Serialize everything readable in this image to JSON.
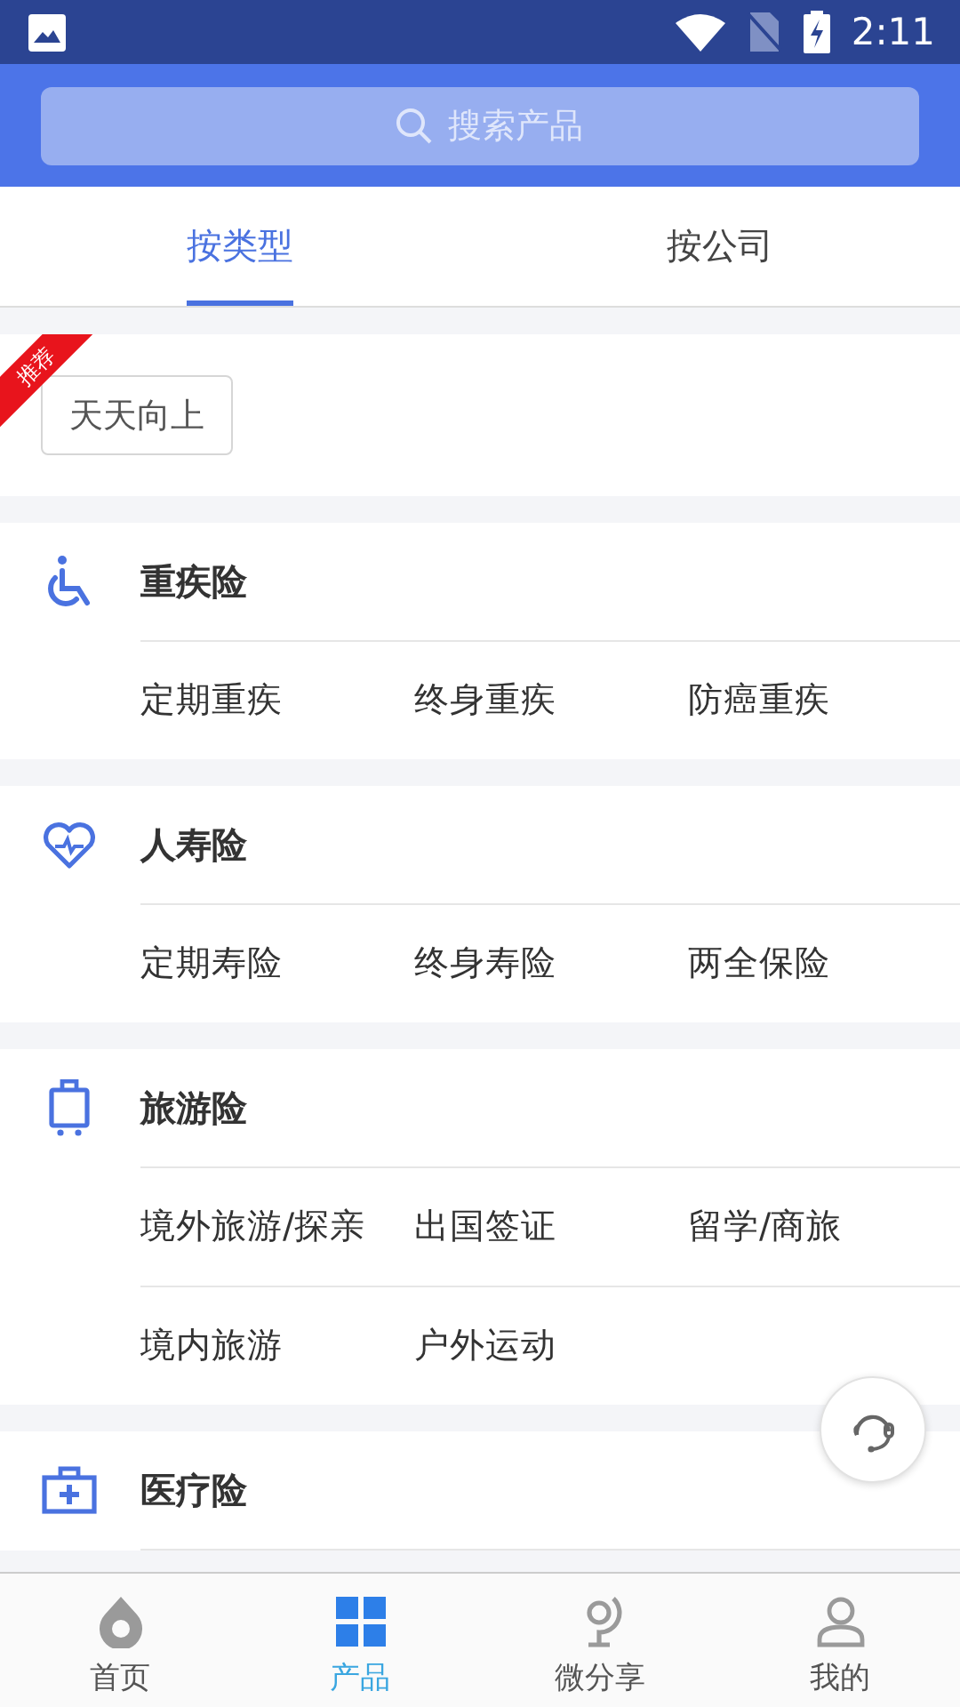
{
  "status_bar": {
    "time": "2:11"
  },
  "search": {
    "placeholder": "搜索产品"
  },
  "tabs": [
    {
      "label": "按类型",
      "selected": true
    },
    {
      "label": "按公司",
      "selected": false
    }
  ],
  "recommended": {
    "badge": "推荐",
    "chips": [
      "天天向上"
    ]
  },
  "categories": [
    {
      "kind": "wheelchair",
      "title": "重疾险",
      "items": [
        "定期重疾",
        "终身重疾",
        "防癌重疾"
      ]
    },
    {
      "kind": "heart",
      "title": "人寿险",
      "items": [
        "定期寿险",
        "终身寿险",
        "两全保险"
      ]
    },
    {
      "kind": "luggage",
      "title": "旅游险",
      "items": [
        "境外旅游/探亲",
        "出国签证",
        "留学/商旅",
        "境内旅游",
        "户外运动"
      ]
    },
    {
      "kind": "medkit",
      "title": "医疗险"
    }
  ],
  "bottom_nav": [
    {
      "kind": "drop",
      "label": "首页",
      "selected": false
    },
    {
      "kind": "grid",
      "label": "产品",
      "selected": true
    },
    {
      "kind": "globe",
      "label": "微分享",
      "selected": false
    },
    {
      "kind": "person",
      "label": "我的",
      "selected": false
    }
  ]
}
